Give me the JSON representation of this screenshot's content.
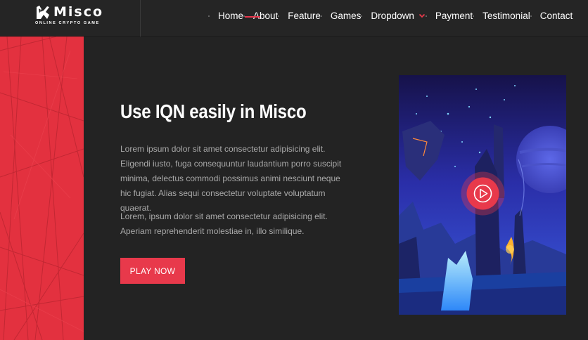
{
  "brand": {
    "name": "Misco",
    "tagline": "ONLINE CRYPTO GAME",
    "icon": "logo-mark-icon"
  },
  "nav": {
    "items": [
      {
        "label": "Home"
      },
      {
        "label": "About",
        "active": true
      },
      {
        "label": "Feature"
      },
      {
        "label": "Games"
      },
      {
        "label": "Dropdown",
        "has_dropdown": true
      },
      {
        "label": "Payment"
      },
      {
        "label": "Testimonial"
      },
      {
        "label": "Contact"
      }
    ]
  },
  "hero": {
    "title": "Use IQN easily in Misco",
    "paragraphs": [
      "Lorem ipsum dolor sit amet consectetur adipisicing elit. Eligendi iusto, fuga consequuntur laudantium porro suscipit minima, delectus commodi possimus animi nesciunt neque hic fugiat. Alias sequi consectetur voluptate voluptatum quaerat.",
      "Lorem, ipsum dolor sit amet consectetur adipisicing elit. Aperiam reprehenderit molestiae in, illo similique."
    ],
    "cta_label": "PLAY NOW",
    "video_icon": "play-icon"
  },
  "colors": {
    "accent": "#e8394b",
    "band": "#e3313f",
    "background": "#232323",
    "topbar": "#252525",
    "text_muted": "#a9a9a9"
  }
}
